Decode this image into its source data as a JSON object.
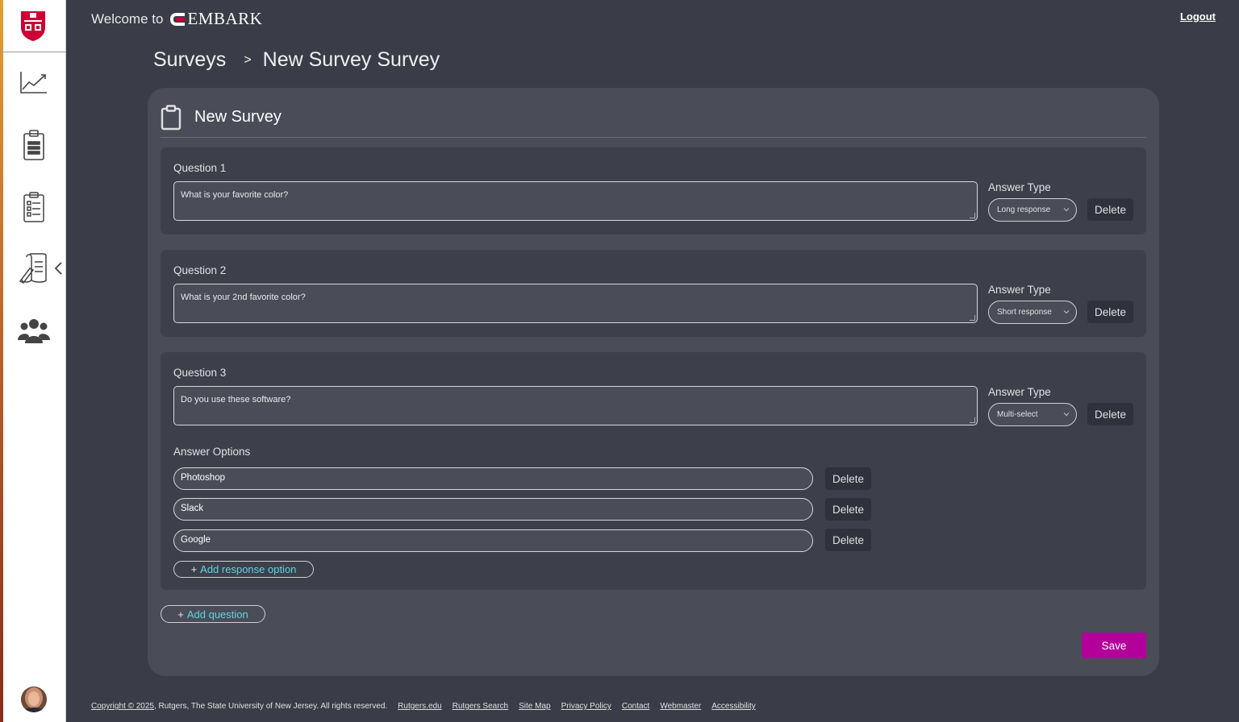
{
  "header": {
    "welcome": "Welcome to",
    "brand": "EMBARK",
    "logout": "Logout"
  },
  "sidebar": {
    "items": [
      {
        "icon": "chart-line-icon"
      },
      {
        "icon": "clipboard-icon"
      },
      {
        "icon": "checklist-icon"
      },
      {
        "icon": "scroll-quill-icon"
      },
      {
        "icon": "users-group-icon"
      }
    ]
  },
  "breadcrumb": {
    "root": "Surveys",
    "separator": ">",
    "current": "New Survey Survey"
  },
  "card": {
    "title": "New Survey"
  },
  "questions": [
    {
      "label": "Question 1",
      "text": "What is your favorite color?",
      "answer_type_label": "Answer Type",
      "answer_type": "Long response",
      "delete": "Delete"
    },
    {
      "label": "Question 2",
      "text": "What is your 2nd favorite color?",
      "answer_type_label": "Answer Type",
      "answer_type": "Short response",
      "delete": "Delete"
    },
    {
      "label": "Question 3",
      "text": "Do you use these software?",
      "answer_type_label": "Answer Type",
      "answer_type": "Multi-select",
      "delete": "Delete",
      "options_label": "Answer Options",
      "options": [
        {
          "value": "Photoshop",
          "delete": "Delete"
        },
        {
          "value": "Slack",
          "delete": "Delete"
        },
        {
          "value": "Google",
          "delete": "Delete"
        }
      ],
      "add_option": "Add response option"
    }
  ],
  "add_question": "Add question",
  "save": "Save",
  "colors": {
    "background": "#3a3d47",
    "card": "#4a4d58",
    "accent_link": "#5fd3e0",
    "save_button": "#b3009a"
  },
  "footer": {
    "copyright_link": "Copyright © 2025",
    "copyright_text": ", Rutgers, The State University of New Jersey. All rights reserved.",
    "links": [
      "Rutgers.edu",
      "Rutgers Search",
      "Site Map",
      "Privacy Policy",
      "Contact",
      "Webmaster",
      "Accessibility"
    ]
  }
}
